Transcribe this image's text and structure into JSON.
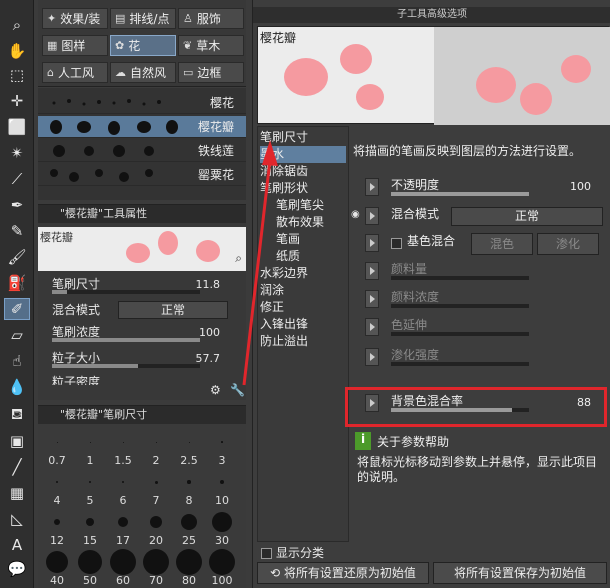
{
  "subtool_group": {
    "buttons": [
      {
        "label": "效果/装",
        "icon": "sparkle-icon"
      },
      {
        "label": "排线/点",
        "icon": "hatch-icon"
      },
      {
        "label": "服饰",
        "icon": "clothes-icon"
      },
      {
        "label": "图样",
        "icon": "grid-icon"
      },
      {
        "label": "花",
        "icon": "flower-icon"
      },
      {
        "label": "草木",
        "icon": "leaf-icon"
      },
      {
        "label": "人工风",
        "icon": "building-icon"
      },
      {
        "label": "自然风",
        "icon": "cloud-icon"
      },
      {
        "label": "边框",
        "icon": "frame-icon"
      }
    ]
  },
  "brush_list": {
    "items": [
      {
        "label": "樱花"
      },
      {
        "label": "樱花瓣"
      },
      {
        "label": "铁线莲"
      },
      {
        "label": "罂粟花"
      }
    ]
  },
  "tool_property": {
    "title": "\"樱花瓣\"工具属性",
    "preview_label": "樱花瓣",
    "rows": [
      {
        "label": "笔刷尺寸",
        "value": "11.8",
        "fill": 0.1
      },
      {
        "label": "混合模式",
        "value": "正常"
      },
      {
        "label": "笔刷浓度",
        "value": "100",
        "fill": 1.0
      },
      {
        "label": "粒子大小",
        "value": "57.7",
        "fill": 0.58
      },
      {
        "label": "粒子密度"
      }
    ]
  },
  "brush_size": {
    "title": "\"樱花瓣\"笔刷尺寸",
    "sizes": [
      "0.7",
      "1",
      "1.5",
      "2",
      "2.5",
      "3",
      "4",
      "5",
      "6",
      "7",
      "8",
      "10",
      "12",
      "15",
      "17",
      "20",
      "25",
      "30",
      "40",
      "50",
      "60",
      "70",
      "80",
      "100"
    ]
  },
  "dialog": {
    "title": "子工具高级选项",
    "preview_label": "樱花瓣",
    "categories": [
      {
        "label": "笔刷尺寸",
        "sub": false,
        "selected": false
      },
      {
        "label": "墨水",
        "sub": false,
        "selected": true
      },
      {
        "label": "消除锯齿",
        "sub": false,
        "selected": false
      },
      {
        "label": "笔刷形状",
        "sub": false,
        "selected": false
      },
      {
        "label": "笔刷笔尖",
        "sub": true,
        "selected": false
      },
      {
        "label": "散布效果",
        "sub": true,
        "selected": false
      },
      {
        "label": "笔画",
        "sub": true,
        "selected": false
      },
      {
        "label": "纸质",
        "sub": true,
        "selected": false
      },
      {
        "label": "水彩边界",
        "sub": false,
        "selected": false
      },
      {
        "label": "润涂",
        "sub": false,
        "selected": false
      },
      {
        "label": "修正",
        "sub": false,
        "selected": false
      },
      {
        "label": "入锋出锋",
        "sub": false,
        "selected": false
      },
      {
        "label": "防止溢出",
        "sub": false,
        "selected": false
      }
    ],
    "description": "将描画的笔画反映到图层的方法进行设置。",
    "settings": {
      "opacity": {
        "label": "不透明度",
        "value": "100",
        "fill": 1.0
      },
      "blend_mode": {
        "label": "混合模式",
        "value": "正常"
      },
      "base_blend": {
        "label": "基色混合",
        "option1": "混色",
        "option2": "渗化"
      },
      "paint_amount": {
        "label": "颜料量"
      },
      "paint_density": {
        "label": "颜料浓度"
      },
      "color_stretch": {
        "label": "色延伸"
      },
      "blur_strength": {
        "label": "渗化强度"
      },
      "bg_blend_rate": {
        "label": "背景色混合率",
        "value": "88",
        "fill": 0.88
      }
    },
    "help": {
      "title": "关于参数帮助",
      "text": "将鼠标光标移动到参数上并悬停，显示此项目的说明。"
    },
    "show_category_label": "显示分类",
    "reset_button": "将所有设置还原为初始值",
    "save_button": "将所有设置保存为初始值"
  },
  "colors": {
    "highlight": "#e0262c",
    "petal": "#f59aa0",
    "selected": "#5f7f9f"
  }
}
